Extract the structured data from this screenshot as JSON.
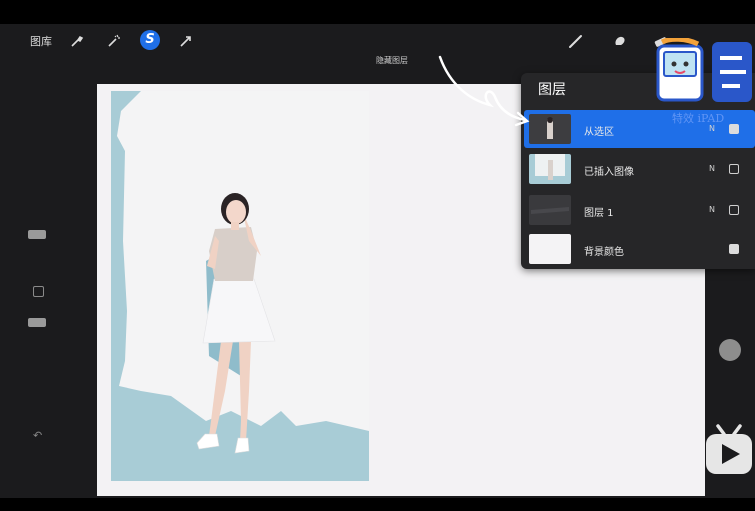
{
  "toolbar": {
    "gallery_label": "图库",
    "actions": [
      "wrench-icon",
      "magic-wand-icon",
      "selection-icon",
      "transform-icon"
    ],
    "selection_symbol": "S",
    "tools": [
      "brush-icon",
      "smudge-icon",
      "eraser-icon"
    ]
  },
  "hint": {
    "hide_layer_label": "隐藏图层"
  },
  "layers": {
    "title": "图层",
    "items": [
      {
        "name": "从选区",
        "mode": "N",
        "visible": true,
        "active": true
      },
      {
        "name": "已插入图像",
        "mode": "N",
        "visible": false,
        "active": false
      },
      {
        "name": "图层 1",
        "mode": "N",
        "visible": false,
        "active": false
      },
      {
        "name": "背景颜色",
        "mode": "",
        "visible": true,
        "active": false
      }
    ]
  },
  "watermark": {
    "text": "特效 iPAD"
  },
  "colors": {
    "accent": "#1f6fe8",
    "panel": "#262628",
    "canvas": "#f3f2f4",
    "photo_backdrop": "#a8ccd6"
  }
}
